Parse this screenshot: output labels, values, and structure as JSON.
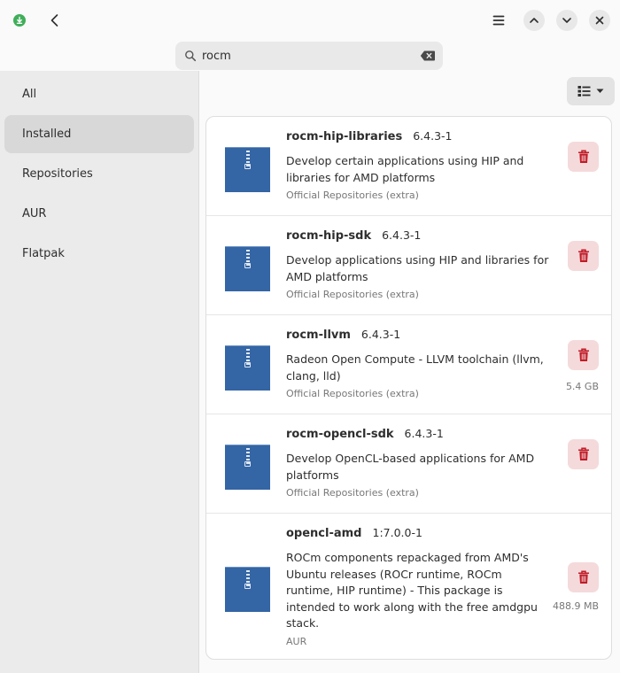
{
  "header": {
    "icons": [
      "app-download-icon",
      "back-icon",
      "menu-icon",
      "previous-icon",
      "next-icon",
      "close-icon"
    ],
    "search": {
      "value": "rocm",
      "placeholder": ""
    }
  },
  "sidebar": {
    "items": [
      {
        "label": "All",
        "active": false
      },
      {
        "label": "Installed",
        "active": true
      },
      {
        "label": "Repositories",
        "active": false
      },
      {
        "label": "AUR",
        "active": false
      },
      {
        "label": "Flatpak",
        "active": false
      }
    ]
  },
  "packages": [
    {
      "name": "rocm-hip-libraries",
      "version": "6.4.3-1",
      "description": "Develop certain applications using HIP and libraries for AMD platforms",
      "repository": "Official Repositories (extra)",
      "size": ""
    },
    {
      "name": "rocm-hip-sdk",
      "version": "6.4.3-1",
      "description": "Develop applications using HIP and libraries for AMD platforms",
      "repository": "Official Repositories (extra)",
      "size": ""
    },
    {
      "name": "rocm-llvm",
      "version": "6.4.3-1",
      "description": "Radeon Open Compute - LLVM toolchain (llvm, clang, lld)",
      "repository": "Official Repositories (extra)",
      "size": "5.4 GB"
    },
    {
      "name": "rocm-opencl-sdk",
      "version": "6.4.3-1",
      "description": "Develop OpenCL-based applications for AMD platforms",
      "repository": "Official Repositories (extra)",
      "size": ""
    },
    {
      "name": "opencl-amd",
      "version": "1:7.0.0-1",
      "description": "ROCm components repackaged from AMD's Ubuntu releases (ROCr runtime, ROCm runtime, HIP runtime) - This package is intended to work along with the free amdgpu stack.",
      "repository": "AUR",
      "size": "488.9 MB"
    }
  ],
  "colors": {
    "accent_delete": "#c01c28",
    "delete_bg": "#f5dadb",
    "package_icon": "#3465a4",
    "app_icon": "#3fae5a"
  }
}
